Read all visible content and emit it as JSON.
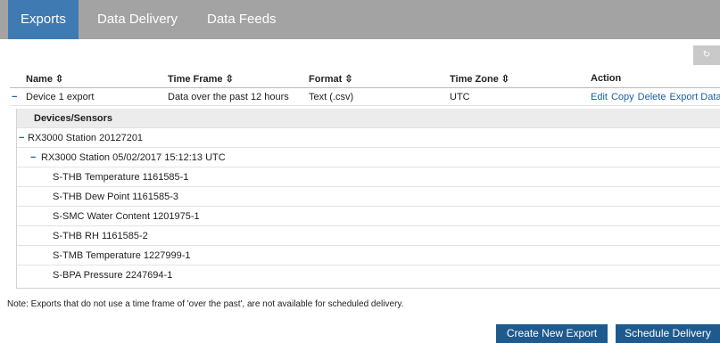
{
  "tabs": [
    "Exports",
    "Data Delivery",
    "Data Feeds"
  ],
  "refresh_icon": "refresh-icon",
  "table": {
    "headers": [
      "Name ⇳",
      "Time Frame ⇳",
      "Format ⇳",
      "Time Zone ⇳",
      "Action"
    ],
    "row": {
      "name": "Device 1 export",
      "time_frame": "Data over the past 12 hours",
      "format": "Text (.csv)",
      "time_zone": "UTC",
      "actions": [
        "Edit",
        "Copy",
        "Delete",
        "Export Data"
      ]
    }
  },
  "devices": {
    "header": "Devices/Sensors",
    "station": "RX3000 Station 20127201",
    "snapshot": "RX3000 Station 05/02/2017 15:12:13 UTC",
    "sensors": [
      "S-THB Temperature 1161585-1",
      "S-THB Dew Point 1161585-3",
      "S-SMC Water Content 1201975-1",
      "S-THB RH 1161585-2",
      "S-TMB Temperature 1227999-1",
      "S-BPA Pressure 2247694-1"
    ]
  },
  "note": "Note:  Exports that do not use a time frame of 'over the past', are not available for scheduled delivery.",
  "buttons": {
    "create": "Create New Export",
    "schedule": "Schedule Delivery"
  }
}
